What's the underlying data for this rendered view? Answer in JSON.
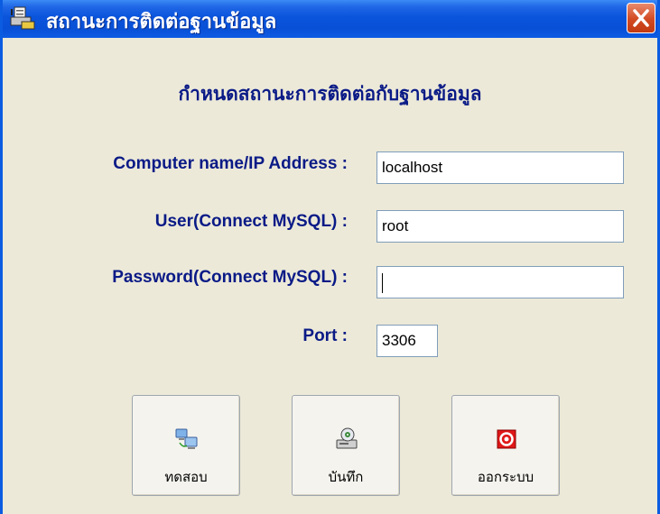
{
  "window": {
    "title": "สถานะการติดต่อฐานข้อมูล",
    "heading": "กำหนดสถานะการติดต่อกับฐานข้อมูล"
  },
  "form": {
    "computer_label": "Computer name/IP Address :",
    "computer_value": "localhost",
    "user_label": "User(Connect MySQL) :",
    "user_value": "root",
    "password_label": "Password(Connect MySQL) :",
    "password_value": "",
    "port_label": "Port :",
    "port_value": "3306"
  },
  "buttons": {
    "test_label": "ทดสอบ",
    "test_icon": "network-computers-icon",
    "save_label": "บันทึก",
    "save_icon": "computer-disk-icon",
    "exit_label": "ออกระบบ",
    "exit_icon": "power-off-icon"
  },
  "colors": {
    "titlebar": "#0A54DC",
    "label_text": "#0A1A86",
    "window_bg": "#ECE9D8",
    "close_button": "#D24A22"
  }
}
